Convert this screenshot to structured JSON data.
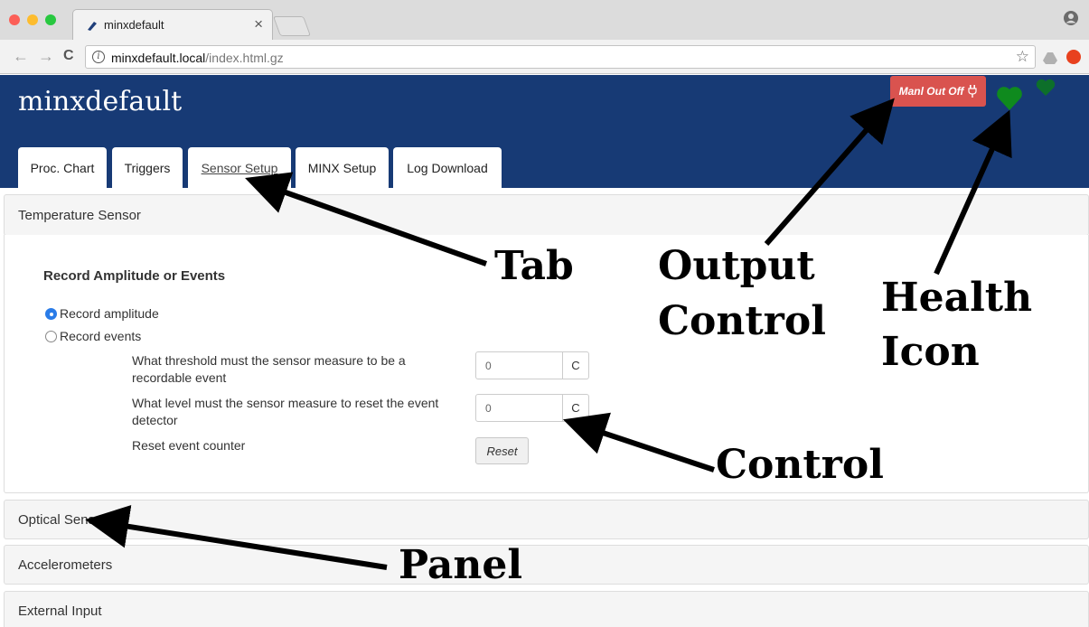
{
  "browser": {
    "tab_title": "minxdefault",
    "tab_close": "×",
    "url_host": "minxdefault.local",
    "url_path": "/index.html.gz",
    "info_glyph": "i",
    "back_glyph": "←",
    "forward_glyph": "→",
    "reload_glyph": "C",
    "star_glyph": "☆",
    "traffic_colors": [
      "#fc5f57",
      "#fdbc2e",
      "#28c840"
    ]
  },
  "app": {
    "title": "minxdefault",
    "manual_output_label": "Manl Out Off",
    "output_button_color": "#d9534f",
    "header_color": "#173a75",
    "health_color": "#0f8a1e",
    "tabs": [
      {
        "label": "Proc. Chart",
        "active": false
      },
      {
        "label": "Triggers",
        "active": false
      },
      {
        "label": "Sensor Setup",
        "active": true
      },
      {
        "label": "MINX Setup",
        "active": false
      },
      {
        "label": "Log Download",
        "active": false
      }
    ]
  },
  "panels": {
    "temperature": {
      "heading": "Temperature Sensor",
      "section_title": "Record Amplitude or Events",
      "radio_amplitude": "Record amplitude",
      "radio_events": "Record events",
      "selected": "Record amplitude",
      "threshold_label": "What threshold must the sensor measure to be a recordable event",
      "threshold_value": "0",
      "threshold_unit": "C",
      "reset_level_label": "What level must the sensor measure to reset the event detector",
      "reset_level_value": "0",
      "reset_level_unit": "C",
      "counter_label": "Reset event counter",
      "reset_button": "Reset"
    },
    "others": [
      "Optical Sensors",
      "Accelerometers",
      "External Input"
    ]
  },
  "annotations": {
    "tab": "Tab",
    "output_control_1": "Output",
    "output_control_2": "Control",
    "health_icon_1": "Health",
    "health_icon_2": "Icon",
    "control": "Control",
    "panel": "Panel"
  }
}
